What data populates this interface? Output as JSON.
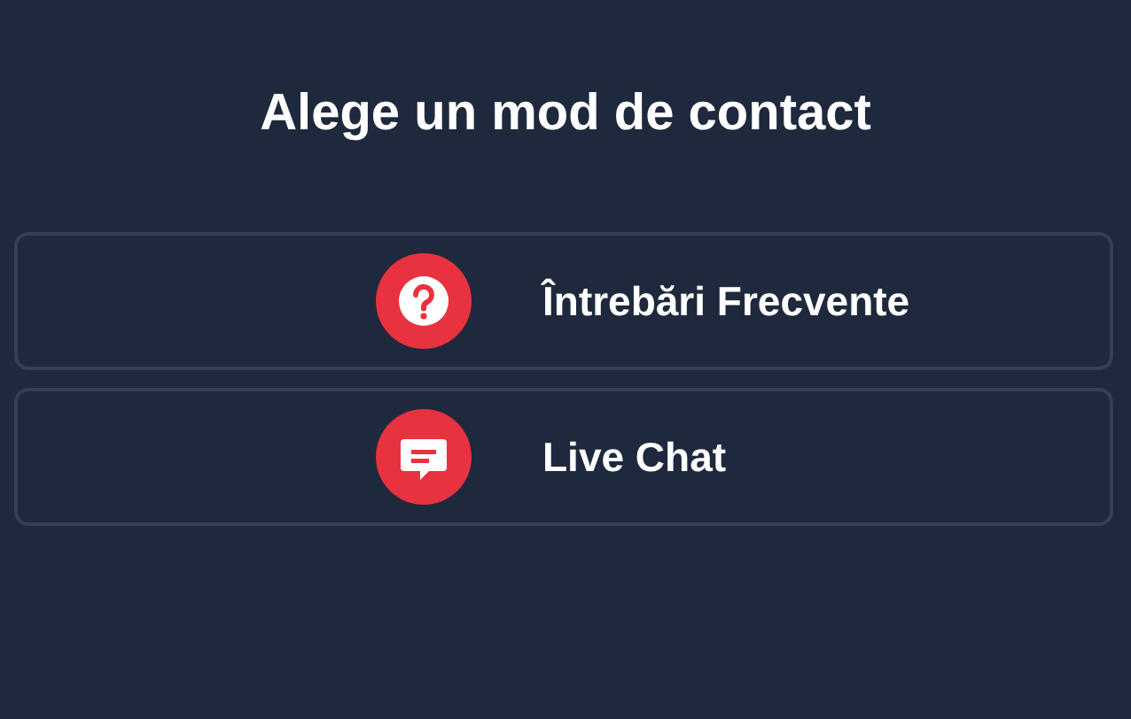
{
  "title": "Alege un mod de contact",
  "options": [
    {
      "kind": "faq",
      "label": "Întrebări Frecvente"
    },
    {
      "kind": "chat",
      "label": "Live Chat"
    }
  ]
}
